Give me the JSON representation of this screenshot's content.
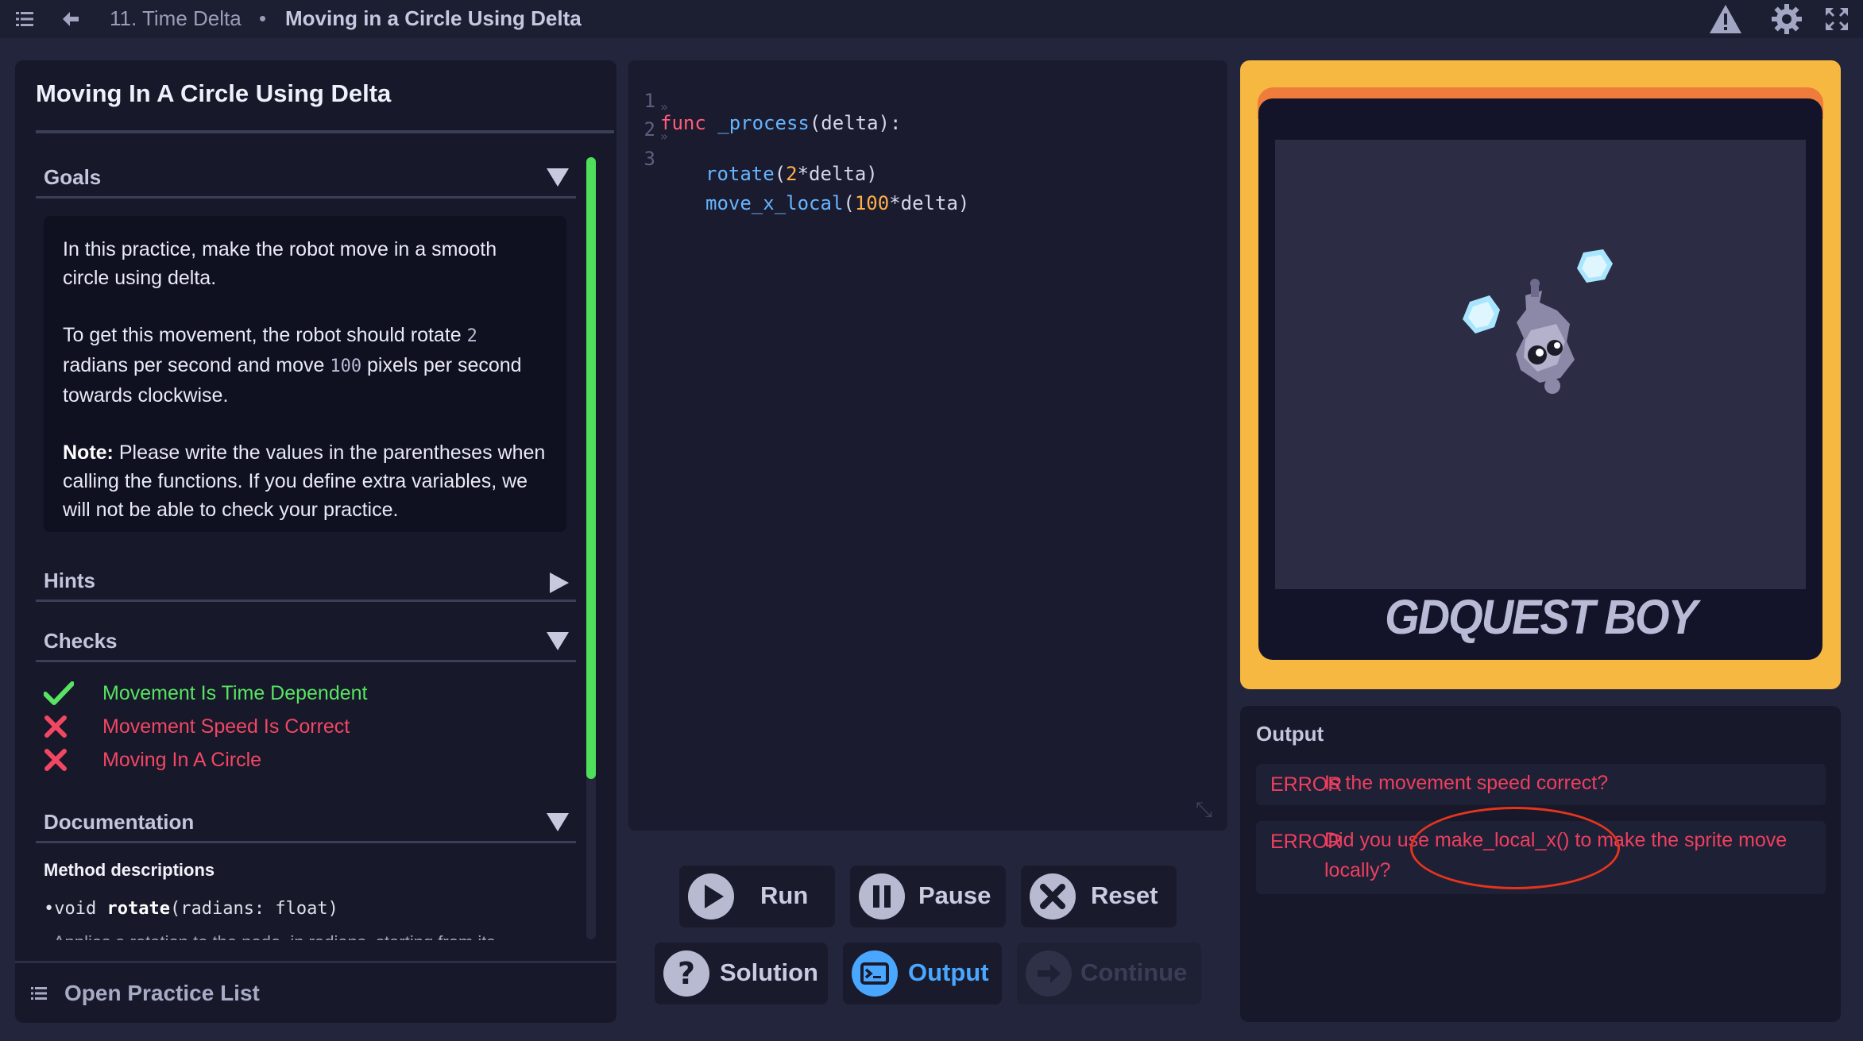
{
  "topbar": {
    "chapter": "11. Time Delta",
    "separator": "•",
    "lesson": "Moving in a Circle Using Delta"
  },
  "left_panel": {
    "title": "Moving In A Circle Using Delta",
    "goals": {
      "label": "Goals",
      "p1": "In this practice, make the robot move in a smooth circle using delta.",
      "p2_a": "To get this movement, the robot should rotate ",
      "p2_code1": "2",
      "p2_b": " radians per second and move ",
      "p2_code2": "100",
      "p2_c": " pixels per second towards clockwise.",
      "note_bold": "Note:",
      "note_text": " Please write the values in the parentheses when calling the functions. If you define extra variables, we will not be able to check your practice."
    },
    "hints": {
      "label": "Hints"
    },
    "checks": {
      "label": "Checks",
      "items": [
        {
          "label": "Movement Is Time Dependent",
          "status": "pass"
        },
        {
          "label": "Movement Speed Is Correct",
          "status": "fail"
        },
        {
          "label": "Moving In A Circle",
          "status": "fail"
        }
      ]
    },
    "documentation": {
      "label": "Documentation",
      "subtitle": "Method descriptions",
      "method_bullet": "•",
      "method_return": "void",
      "method_name": "rotate",
      "method_params_open": "(",
      "method_param_name": "radians:",
      "method_param_type": " float",
      "method_params_close": ")",
      "method_desc": "Applies a rotation to the node, in radians, starting from its"
    },
    "open_list_label": "Open Practice List"
  },
  "editor": {
    "lines": [
      {
        "n": "1",
        "kw": "func",
        "name": "_process",
        "rest": "(delta):"
      },
      {
        "n": "2",
        "fn": "rotate",
        "open": "(",
        "num": "2",
        "rest": "*delta)"
      },
      {
        "n": "3",
        "fn": "move_x_local",
        "open": "(",
        "num": "100",
        "rest": "*delta)"
      }
    ]
  },
  "buttons": {
    "run": "Run",
    "pause": "Pause",
    "reset": "Reset",
    "solution": "Solution",
    "output": "Output",
    "continue": "Continue"
  },
  "viewport": {
    "brand": "GDQUEST BOY"
  },
  "output": {
    "title": "Output",
    "errors": [
      {
        "tag": "ERROR",
        "msg": "Is the movement speed correct?"
      },
      {
        "tag": "ERROR",
        "msg1": "Did you use make_local_x() to make the sprite move",
        "msg2": "locally?"
      }
    ]
  },
  "colors": {
    "accent_green": "#58e362",
    "error_red": "#ee3f5f",
    "output_blue": "#4aa7ff",
    "frame_yellow": "#f6b840"
  }
}
